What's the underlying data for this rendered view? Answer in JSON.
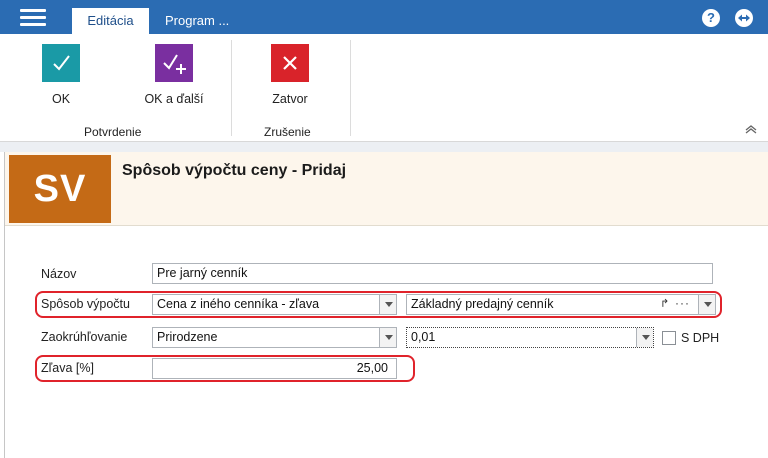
{
  "titlebar": {
    "tabs": [
      {
        "label": "Editácia",
        "active": true
      },
      {
        "label": "Program ..."
      }
    ],
    "help_symbol": "?",
    "accent": "#2b6cb3"
  },
  "ribbon": {
    "ok": {
      "label": "OK",
      "icon": "checkmark-icon",
      "color": "#1a9aa6"
    },
    "ok_next": {
      "label": "OK a ďalší",
      "icon": "checkmark-plus-icon",
      "color": "#7a2fa0"
    },
    "close": {
      "label": "Zatvor",
      "icon": "close-icon",
      "color": "#d9232a"
    },
    "groups": [
      "Potvrdenie",
      "Zrušenie"
    ]
  },
  "form": {
    "badge": "SV",
    "badge_color": "#c46a16",
    "title": "Spôsob výpočtu ceny - Pridaj",
    "fields": {
      "name": {
        "label": "Názov",
        "value": "Pre jarný cenník"
      },
      "method": {
        "label": "Spôsob výpočtu",
        "value": "Cena z iného cenníka - zľava",
        "source_value": "Základný predajný cenník"
      },
      "rounding": {
        "label": "Zaokrúhľovanie",
        "value": "Prirodzene",
        "precision": "0,01"
      },
      "vat": {
        "label": "S DPH",
        "checked": false
      },
      "discount": {
        "label": "Zľava [%]",
        "value": "25,00"
      }
    }
  }
}
